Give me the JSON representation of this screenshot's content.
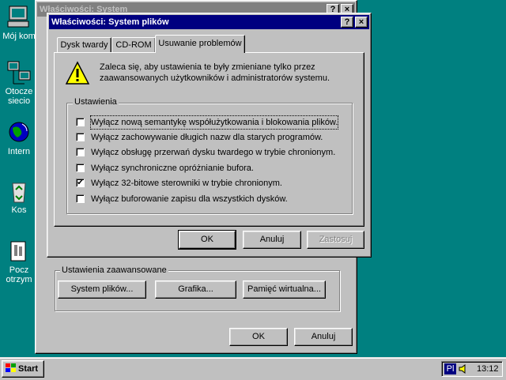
{
  "desktop": {
    "icons": [
      {
        "label": "Mój kom",
        "icon": "my-computer-icon"
      },
      {
        "label": "Otocze",
        "label2": "siecio",
        "icon": "network-icon"
      },
      {
        "label": "Intern",
        "icon": "internet-icon"
      },
      {
        "label": "Kos",
        "icon": "recycle-bin-icon"
      },
      {
        "label": "Pocz",
        "label2": "otrzym",
        "icon": "inbox-icon"
      }
    ]
  },
  "back_window": {
    "title": "Właściwości: System",
    "help_btn": "?",
    "close_btn": "×",
    "advanced_group": {
      "caption": "Ustawienia zaawansowane",
      "buttons": [
        "System plików...",
        "Grafika...",
        "Pamięć wirtualna..."
      ]
    },
    "ok": "OK",
    "cancel": "Anuluj"
  },
  "dialog": {
    "title": "Właściwości: System plików",
    "help_btn": "?",
    "close_btn": "×",
    "tabs": [
      "Dysk twardy",
      "CD-ROM",
      "Usuwanie problemów"
    ],
    "selected_tab": 2,
    "warning_line1": "Zaleca się, aby ustawienia te były zmieniane tylko przez",
    "warning_line2": "zaawansowanych użytkowników i administratorów systemu.",
    "group_caption": "Ustawienia",
    "options": [
      {
        "label": "Wyłącz nową semantykę współużytkowania i blokowania plików.",
        "checked": false
      },
      {
        "label": "Wyłącz zachowywanie długich nazw dla starych programów.",
        "checked": false
      },
      {
        "label": "Wyłącz obsługę przerwań dysku twardego w trybie chronionym.",
        "checked": false
      },
      {
        "label": "Wyłącz synchroniczne opróżnianie bufora.",
        "checked": false
      },
      {
        "label": "Wyłącz 32-bitowe sterowniki w trybie chronionym.",
        "checked": true
      },
      {
        "label": "Wyłącz buforowanie zapisu dla wszystkich dysków.",
        "checked": false
      }
    ],
    "ok": "OK",
    "cancel": "Anuluj",
    "apply": "Zastosuj"
  },
  "taskbar": {
    "start_label": "Start",
    "language": "Pl",
    "clock": "13:12"
  },
  "colors": {
    "desktop": "#008080",
    "titlebar_active": "#000080",
    "titlebar_inactive": "#808080",
    "face": "#c0c0c0"
  }
}
